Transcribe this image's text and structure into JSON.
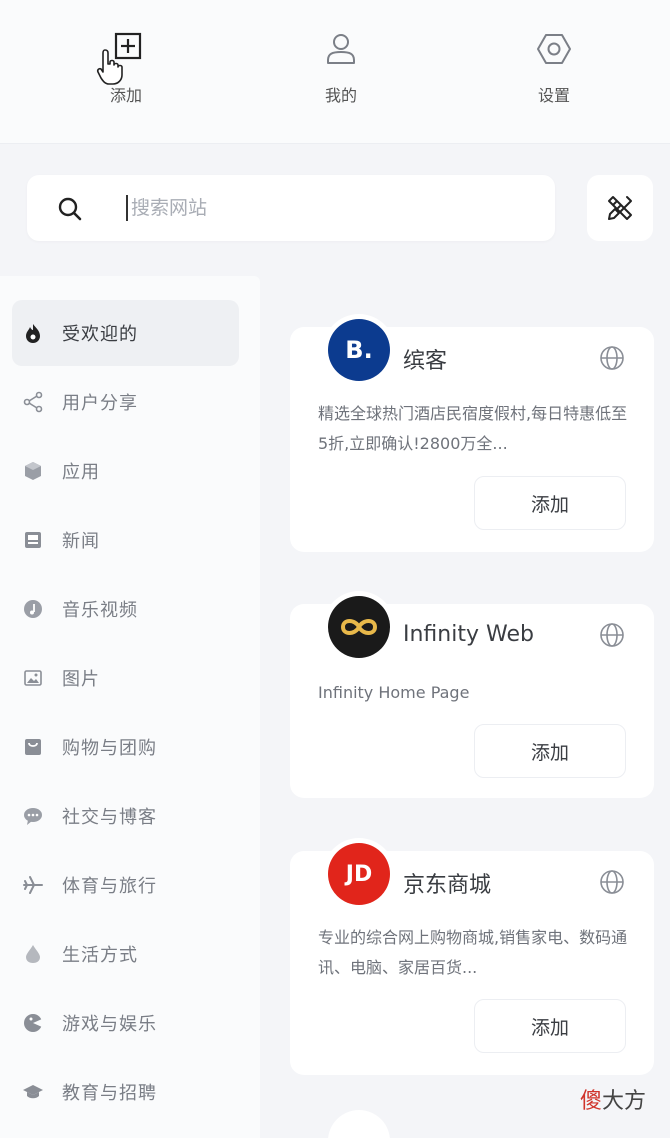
{
  "top_nav": {
    "items": [
      {
        "label": "添加",
        "icon": "add-square-icon"
      },
      {
        "label": "我的",
        "icon": "user-icon"
      },
      {
        "label": "设置",
        "icon": "hexagon-settings-icon"
      }
    ]
  },
  "search": {
    "placeholder": "搜索网站",
    "icon": "search-icon",
    "tool_icon": "tools-icon"
  },
  "sidebar": {
    "items": [
      {
        "label": "受欢迎的",
        "icon": "flame-icon",
        "active": true
      },
      {
        "label": "用户分享",
        "icon": "share-icon"
      },
      {
        "label": "应用",
        "icon": "cube-icon"
      },
      {
        "label": "新闻",
        "icon": "news-icon"
      },
      {
        "label": "音乐视频",
        "icon": "music-icon"
      },
      {
        "label": "图片",
        "icon": "image-icon"
      },
      {
        "label": "购物与团购",
        "icon": "shopping-icon"
      },
      {
        "label": "社交与博客",
        "icon": "chat-icon"
      },
      {
        "label": "体育与旅行",
        "icon": "plane-icon"
      },
      {
        "label": "生活方式",
        "icon": "drop-icon"
      },
      {
        "label": "游戏与娱乐",
        "icon": "game-icon"
      },
      {
        "label": "教育与招聘",
        "icon": "graduation-cap-icon"
      }
    ]
  },
  "cards": [
    {
      "logo_text": "B.",
      "logo_color": "#0c3b8f",
      "title": "缤客",
      "desc": "精选全球热门酒店民宿度假村,每日特惠低至5折,立即确认!2800万全...",
      "button": "添加"
    },
    {
      "logo_text": "∞",
      "logo_color": "#1a1a1a",
      "title": "Infinity Web",
      "desc": "Infinity Home Page",
      "button": "添加"
    },
    {
      "logo_text": "JD",
      "logo_color": "#e1251b",
      "title": "京东商城",
      "desc": "专业的综合网上购物商城,销售家电、数码通讯、电脑、家居百货...",
      "button": "添加"
    }
  ],
  "watermark": {
    "first": "傻",
    "rest": "大方"
  }
}
